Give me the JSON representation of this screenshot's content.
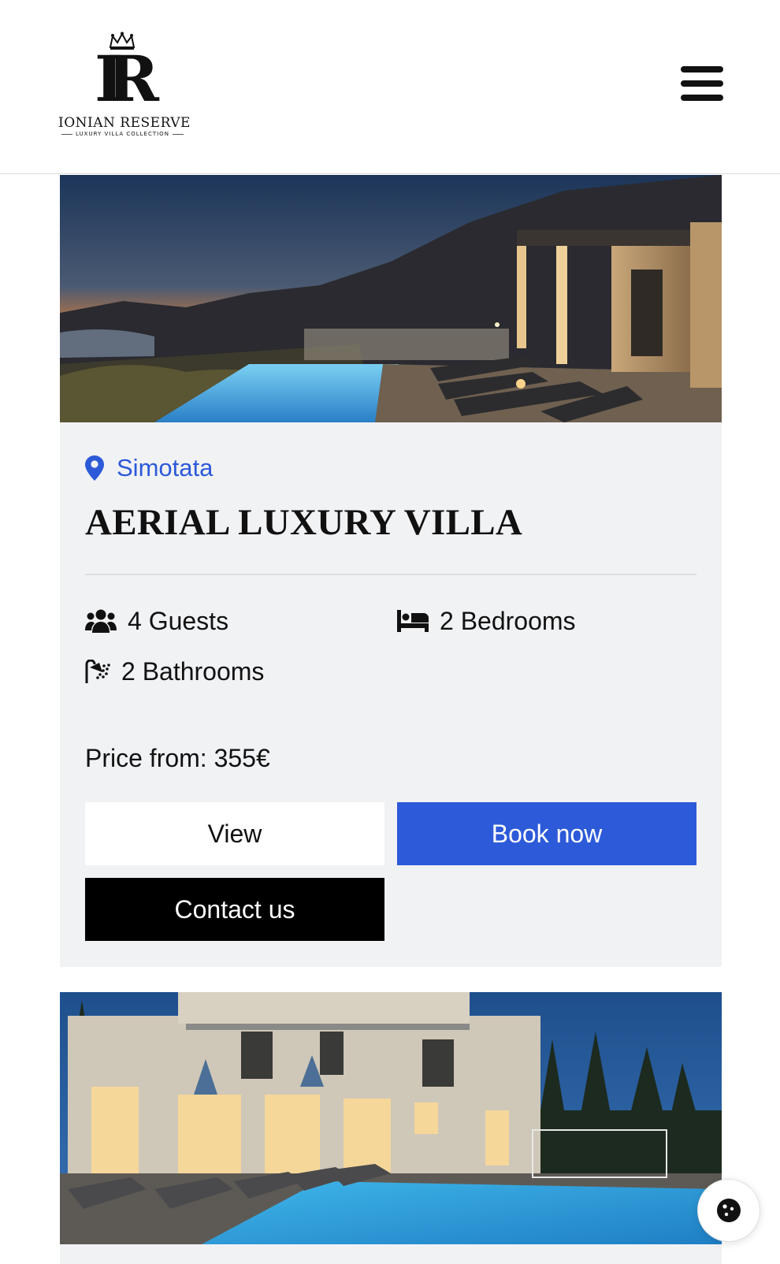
{
  "header": {
    "logo_name": "IONIAN RESERVE",
    "logo_tagline": "LUXURY VILLA COLLECTION",
    "logo_monogram": "IR",
    "menu_icon": "hamburger-menu-icon"
  },
  "listings": [
    {
      "image": "villa-night-pool-photo",
      "location": "Simotata",
      "title": "AERIAL LUXURY VILLA",
      "features": {
        "guests": "4 Guests",
        "bedrooms": "2 Bedrooms",
        "bathrooms": "2 Bathrooms"
      },
      "price": "Price from: 355€",
      "buttons": {
        "view": "View",
        "book": "Book now",
        "contact": "Contact us"
      }
    },
    {
      "image": "stone-villa-night-pool-photo"
    }
  ],
  "colors": {
    "accent": "#2c5ad8",
    "card_bg": "#f1f2f4",
    "contact_bg": "#000000"
  },
  "icons": {
    "location": "map-pin-icon",
    "guests": "users-icon",
    "bedrooms": "bed-icon",
    "bathrooms": "shower-icon",
    "floating": "cookie-icon"
  }
}
